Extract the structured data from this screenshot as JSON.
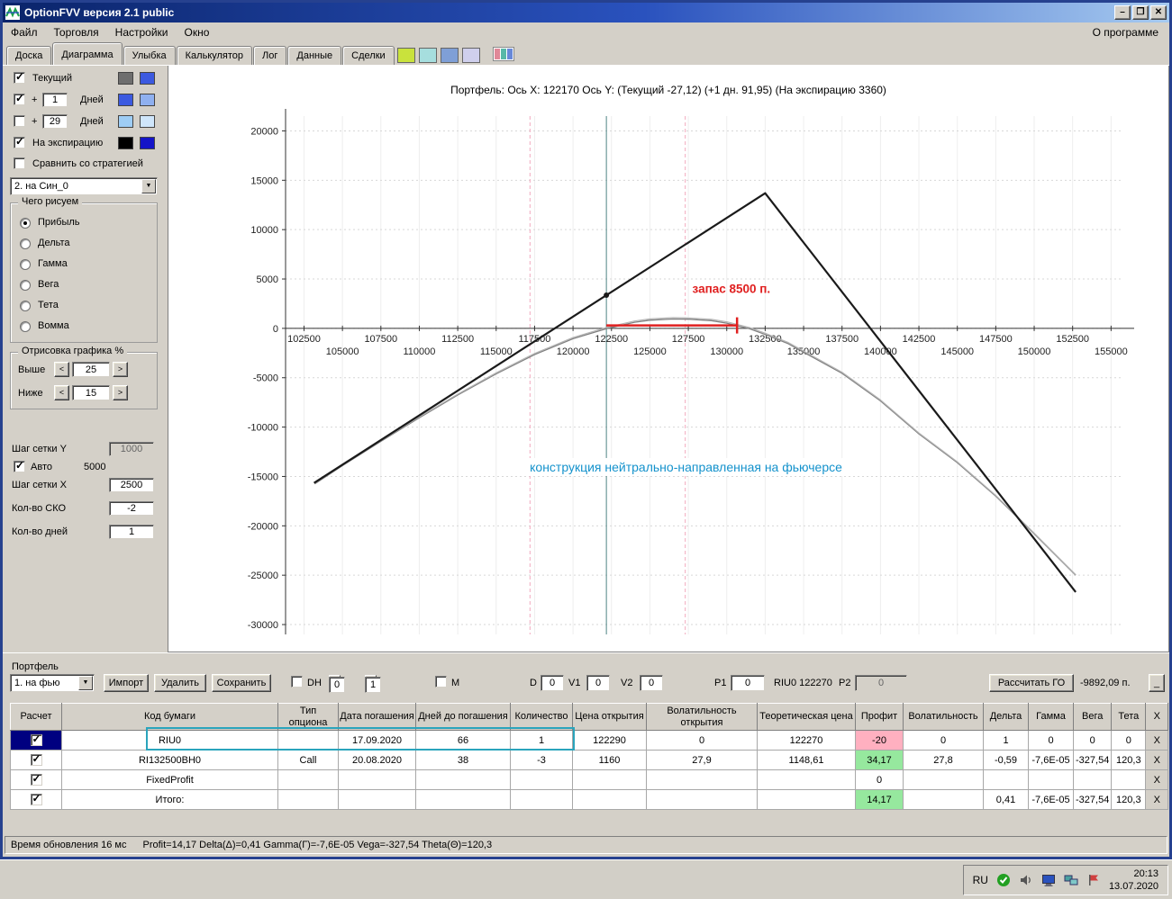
{
  "window": {
    "title": "OptionFVV версия 2.1 public"
  },
  "icons": {
    "minimize": "–",
    "maximize": "❐",
    "close": "✕",
    "dropdown": "▼",
    "spin_up": "▴",
    "spin_down": "▾",
    "left": "<",
    "right": ">"
  },
  "menu": {
    "items": [
      "Файл",
      "Торговля",
      "Настройки",
      "Окно"
    ],
    "about": "О программе"
  },
  "tabbar": {
    "tabs": [
      "Доска",
      "Диаграмма",
      "Улыбка",
      "Калькулятор",
      "Лог",
      "Данные",
      "Сделки"
    ],
    "active_tab": "Диаграмма",
    "swatches": [
      "#c9e23c",
      "#a6dede",
      "#7f9fd6",
      "#cfcfec"
    ],
    "palette": [
      "#e08898",
      "#58b8a8",
      "#6888d8"
    ]
  },
  "sidebar": {
    "rows": [
      {
        "label": "Текущий",
        "checked": true,
        "colors": [
          "#6e6e6e",
          "#3c5ae0"
        ]
      },
      {
        "plus": "+",
        "value": "1",
        "label": "Дней",
        "checked": true,
        "colors": [
          "#3c5ae0",
          "#8fb0f0"
        ]
      },
      {
        "plus": "+",
        "value": "29",
        "label": "Дней",
        "checked": false,
        "colors": [
          "#9ecdf5",
          "#cfe6fb"
        ]
      },
      {
        "label": "На экспирацию",
        "checked": true,
        "colors": [
          "#000000",
          "#1414c8"
        ]
      },
      {
        "label": "Сравнить со стратегией",
        "checked": false
      }
    ],
    "strategy_select": "2. на Син_0",
    "draw_group": {
      "title": "Чего рисуем",
      "options": [
        "Прибыль",
        "Дельта",
        "Гамма",
        "Вега",
        "Тета",
        "Вомма"
      ],
      "selected": "Прибыль"
    },
    "render_group": {
      "title": "Отрисовка графика %",
      "above_label": "Выше",
      "above": "25",
      "below_label": "Ниже",
      "below": "15"
    },
    "grid_y_label": "Шаг сетки Y",
    "grid_y": "1000",
    "auto_label": "Авто",
    "auto_value": "5000",
    "grid_x_label": "Шаг сетки X",
    "grid_x": "2500",
    "sko_label": "Кол-во СКО",
    "sko": "-2",
    "days_label": "Кол-во дней",
    "days": "1"
  },
  "chart_data": {
    "type": "line",
    "title": "Портфель:  Ось X: 122170  Ось Y:  (Текущий -27,12)  (+1 дн. 91,95)  (На экспирацию 3360)",
    "xlim": [
      101300,
      155800
    ],
    "ylim": [
      -31000,
      21500
    ],
    "yticks": [
      20000,
      15000,
      10000,
      5000,
      0,
      -5000,
      -10000,
      -15000,
      -20000,
      -25000,
      -30000
    ],
    "xticks_row1": [
      102500,
      107500,
      112500,
      117500,
      122500,
      127500,
      132500,
      137500,
      142500,
      147500,
      152500
    ],
    "xticks_row2": [
      105000,
      110000,
      115000,
      120000,
      125000,
      130000,
      135000,
      140000,
      145000,
      150000,
      155000
    ],
    "series": [
      {
        "name": "Текущий",
        "color": "#808080",
        "width": 1.3,
        "points": [
          [
            103200,
            -15750
          ],
          [
            105000,
            -13900
          ],
          [
            107500,
            -11450
          ],
          [
            110000,
            -9050
          ],
          [
            112500,
            -6750
          ],
          [
            115000,
            -4600
          ],
          [
            117500,
            -2650
          ],
          [
            120000,
            -1050
          ],
          [
            122170,
            -27
          ],
          [
            124000,
            620
          ],
          [
            125000,
            830
          ],
          [
            126500,
            950
          ],
          [
            127500,
            930
          ],
          [
            129000,
            780
          ],
          [
            130000,
            530
          ],
          [
            131500,
            -50
          ],
          [
            132500,
            -620
          ],
          [
            134000,
            -1550
          ],
          [
            135000,
            -2420
          ],
          [
            137500,
            -4550
          ],
          [
            140000,
            -7350
          ],
          [
            142500,
            -10680
          ],
          [
            145000,
            -13600
          ],
          [
            147500,
            -17000
          ],
          [
            150000,
            -20800
          ],
          [
            152700,
            -25000
          ]
        ]
      },
      {
        "name": "+1 дн.",
        "color": "#b4b4b4",
        "width": 1.2,
        "points": [
          [
            103200,
            -15700
          ],
          [
            105000,
            -13840
          ],
          [
            107500,
            -11380
          ],
          [
            110000,
            -8970
          ],
          [
            112500,
            -6660
          ],
          [
            115000,
            -4500
          ],
          [
            117500,
            -2540
          ],
          [
            120000,
            -930
          ],
          [
            122170,
            92
          ],
          [
            124000,
            750
          ],
          [
            125000,
            960
          ],
          [
            126500,
            1080
          ],
          [
            127500,
            1060
          ],
          [
            129000,
            910
          ],
          [
            130000,
            660
          ],
          [
            131500,
            70
          ],
          [
            132500,
            -490
          ],
          [
            134000,
            -1430
          ],
          [
            135000,
            -2300
          ],
          [
            137500,
            -4440
          ],
          [
            140000,
            -7250
          ],
          [
            142500,
            -10590
          ],
          [
            145000,
            -13520
          ],
          [
            147500,
            -16930
          ],
          [
            150000,
            -20740
          ],
          [
            152700,
            -24950
          ]
        ]
      },
      {
        "name": "На экспирацию",
        "color": "#1a1a1a",
        "width": 2.2,
        "points": [
          [
            103150,
            -15660
          ],
          [
            132500,
            13690
          ],
          [
            152700,
            -26710
          ]
        ]
      }
    ],
    "marker": {
      "x": 122170,
      "y": 3360,
      "color": "#1a1a1a"
    },
    "vlines": [
      {
        "name": "sko-lower-line",
        "x": 117200,
        "color": "#f2aabe",
        "dash": "4,3"
      },
      {
        "name": "sko-upper-line",
        "x": 127300,
        "color": "#f2aabe",
        "dash": "4,3"
      },
      {
        "name": "current-price-line",
        "x": 122170,
        "color": "#4f8585",
        "dash": ""
      }
    ],
    "red_segment": {
      "x1": 122170,
      "x2": 130670,
      "y": 300,
      "color": "#e02020",
      "label": "запас 8500 п.",
      "label_x": 130300,
      "label_y": 3600
    },
    "note": {
      "x": 127350,
      "y": -14500,
      "text": "конструкция нейтрально-направленная на фьючерсе",
      "color": "#1492cc"
    }
  },
  "portfolio": {
    "label": "Портфель",
    "toolbar": {
      "strategy_select": "1. на фью",
      "import": "Импорт",
      "delete": "Удалить",
      "save": "Сохранить",
      "dh_label": "DH",
      "dh_spin1": "0",
      "dh_spin2": "1",
      "m_label": "M",
      "d_label": "D",
      "d_value": "0",
      "v1_label": "V1",
      "v1_value": "0",
      "v2_label": "V2",
      "v2_value": "0",
      "p1_label": "P1",
      "p1_value": "0",
      "instrument": "RIU0 122270",
      "p2_label": "P2",
      "p2_value": "0",
      "calc_go": "Рассчитать ГО",
      "go_value": "-9892,09 п.",
      "collapse": "_"
    },
    "table": {
      "headers": [
        "Расчет",
        "Код бумаги",
        "Тип опциона",
        "Дата погашения",
        "Дней до погашения",
        "Количество",
        "Цена открытия",
        "Волатильность открытия",
        "Теоретическая цена",
        "Профит",
        "Волатильность",
        "Дельта",
        "Гамма",
        "Вега",
        "Тета",
        "X"
      ],
      "delete_label": "X",
      "rows": [
        {
          "cells": [
            "RIU0",
            "",
            "17.09.2020",
            "66",
            "1",
            "122290",
            "0",
            "122270",
            "-20",
            "0",
            "1",
            "0",
            "0",
            "0"
          ]
        },
        {
          "cells": [
            "RI132500BH0",
            "Call",
            "20.08.2020",
            "38",
            "-3",
            "1160",
            "27,9",
            "1148,61",
            "34,17",
            "27,8",
            "-0,59",
            "-7,6E-05",
            "-327,54",
            "120,3"
          ]
        },
        {
          "cells": [
            "FixedProfit",
            "",
            "",
            "",
            "",
            "",
            "",
            "",
            "0",
            "",
            "",
            "",
            "",
            ""
          ]
        },
        {
          "cells": [
            "Итого:",
            "",
            "",
            "",
            "",
            "",
            "",
            "",
            "14,17",
            "",
            "0,41",
            "-7,6E-05",
            "-327,54",
            "120,3"
          ]
        }
      ]
    }
  },
  "statusbar": {
    "update_text": "Время обновления 16 мс",
    "greeks_text": "Profit=14,17 Delta(Δ)=0,41 Gamma(Г)=-7,6E-05 Vega=-327,54 Theta(Θ)=120,3"
  },
  "taskbar": {
    "lang": "RU",
    "time": "20:13",
    "date": "13.07.2020"
  },
  "colors": {
    "profit_pos": "#96e89e",
    "profit_neg": "#ffb0c0",
    "selection": "#000080",
    "accent_cyan": "#2aa4bc"
  }
}
